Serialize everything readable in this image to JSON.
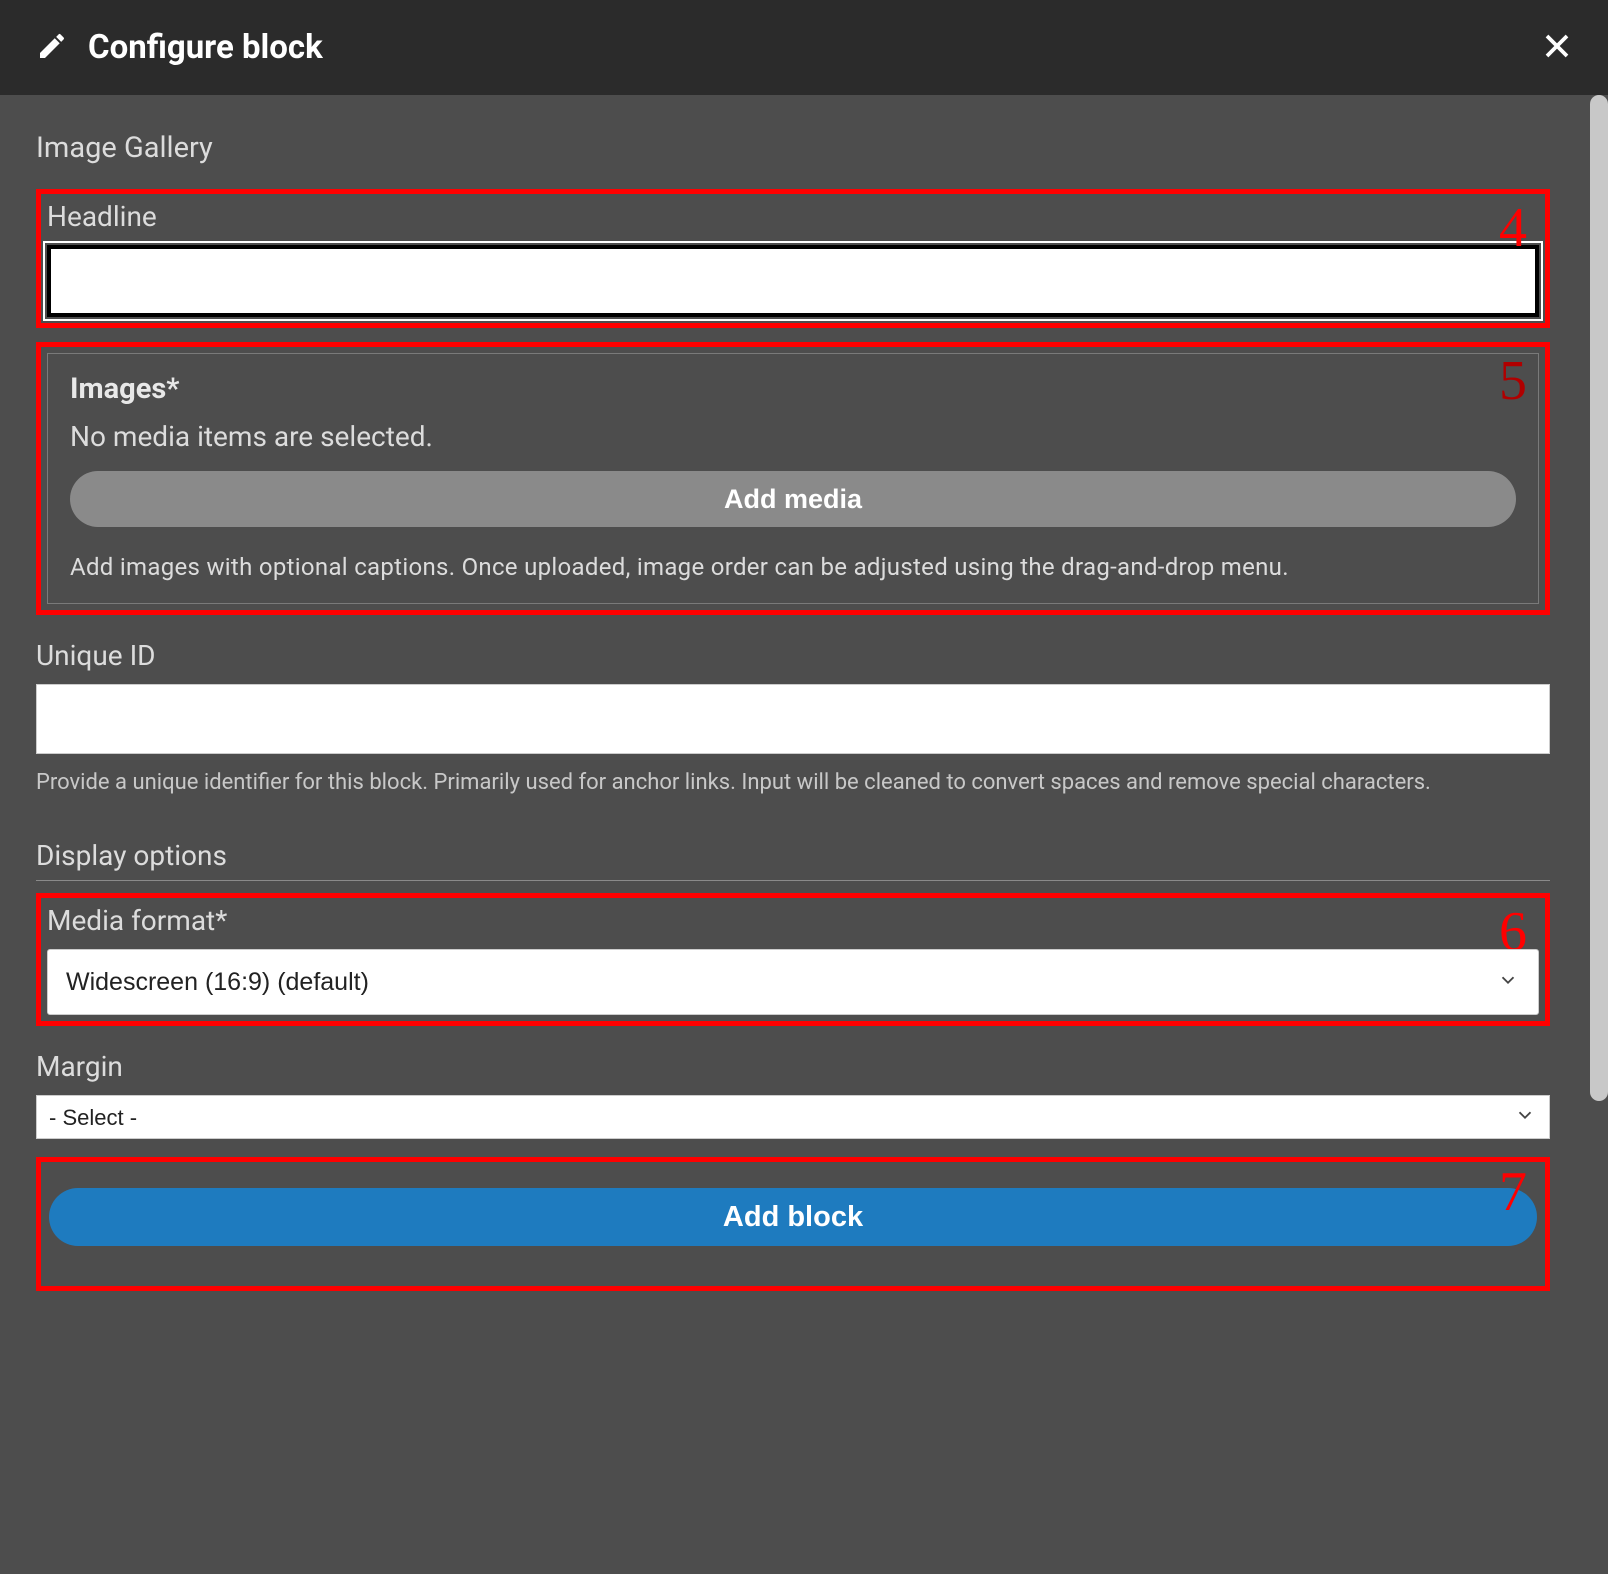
{
  "header": {
    "title": "Configure block"
  },
  "section_title": "Image Gallery",
  "headline": {
    "label": "Headline",
    "value": ""
  },
  "images": {
    "legend": "Images*",
    "empty_text": "No media items are selected.",
    "add_button": "Add media",
    "help": "Add images with optional captions. Once uploaded, image order can be adjusted using the drag-and-drop menu."
  },
  "unique_id": {
    "label": "Unique ID",
    "value": "",
    "help": "Provide a unique identifier for this block. Primarily used for anchor links. Input will be cleaned to convert spaces and remove special characters."
  },
  "display": {
    "title": "Display options",
    "media_format": {
      "label": "Media format*",
      "selected": "Widescreen (16:9) (default)"
    },
    "margin": {
      "label": "Margin",
      "selected": "- Select -"
    }
  },
  "submit": {
    "label": "Add block"
  },
  "annotations": {
    "a4": "4",
    "a5": "5",
    "a6": "6",
    "a7": "7"
  }
}
